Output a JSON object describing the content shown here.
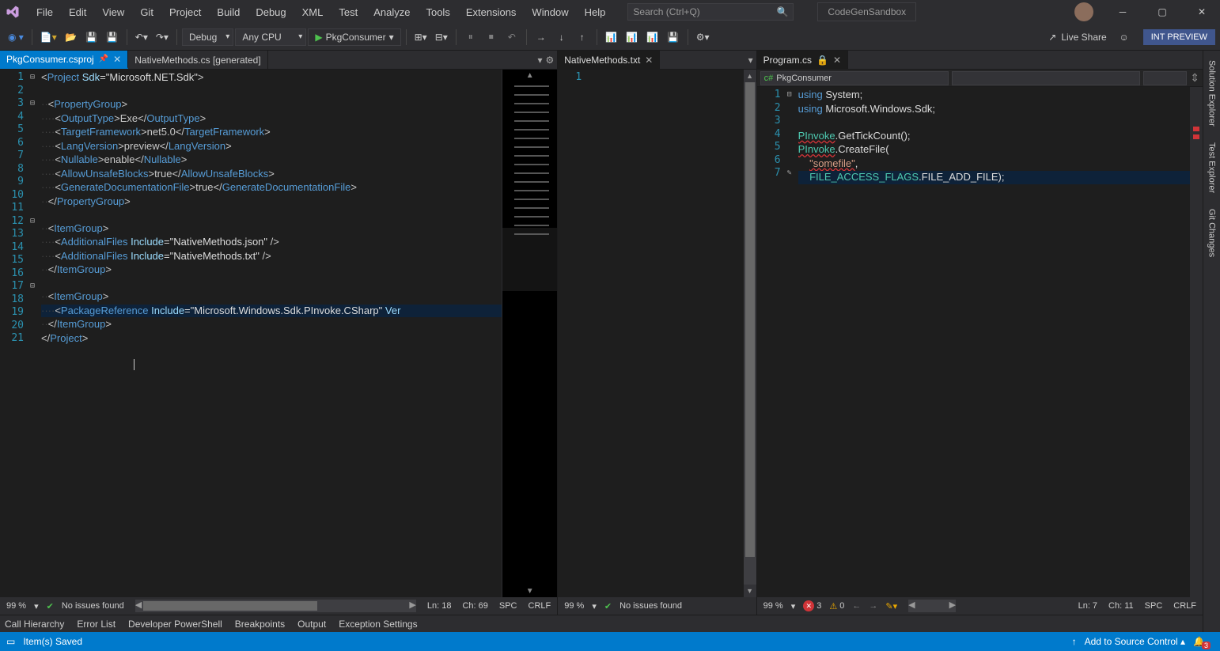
{
  "titlebar": {
    "menus": [
      "File",
      "Edit",
      "View",
      "Git",
      "Project",
      "Build",
      "Debug",
      "XML",
      "Test",
      "Analyze",
      "Tools",
      "Extensions",
      "Window",
      "Help"
    ],
    "search_placeholder": "Search (Ctrl+Q)",
    "solution_name": "CodeGenSandbox"
  },
  "toolbar": {
    "config": "Debug",
    "platform": "Any CPU",
    "run_target": "PkgConsumer",
    "live_share": "Live Share",
    "int_preview": "INT PREVIEW"
  },
  "pane1": {
    "tabs": [
      {
        "label": "PkgConsumer.csproj",
        "active": true,
        "pinned": true
      },
      {
        "label": "NativeMethods.cs [generated]",
        "active": false
      }
    ],
    "lines": 21,
    "status": {
      "zoom": "99 %",
      "issues": "No issues found",
      "ln": "Ln: 18",
      "ch": "Ch: 69",
      "ws": "SPC",
      "eol": "CRLF"
    }
  },
  "pane1_code": {
    "l1": {
      "open": "<",
      "tag": "Project",
      "sp": " ",
      "attr": "Sdk",
      "eq": "=",
      "q": "\"",
      "str": "Microsoft.NET.Sdk",
      "q2": "\"",
      "close": ">"
    },
    "l3": {
      "dots": "··",
      "open": "<",
      "tag": "PropertyGroup",
      "close": ">"
    },
    "l4": {
      "dots": "····",
      "open": "<",
      "tag": "OutputType",
      "close": ">",
      "txt": "Exe",
      "open2": "</",
      "tag2": "OutputType",
      "close2": ">"
    },
    "l5": {
      "dots": "····",
      "open": "<",
      "tag": "TargetFramework",
      "close": ">",
      "txt": "net5.0",
      "open2": "</",
      "tag2": "TargetFramework",
      "close2": ">"
    },
    "l6": {
      "dots": "····",
      "open": "<",
      "tag": "LangVersion",
      "close": ">",
      "txt": "preview",
      "open2": "</",
      "tag2": "LangVersion",
      "close2": ">"
    },
    "l7": {
      "dots": "····",
      "open": "<",
      "tag": "Nullable",
      "close": ">",
      "txt": "enable",
      "open2": "</",
      "tag2": "Nullable",
      "close2": ">"
    },
    "l8": {
      "dots": "····",
      "open": "<",
      "tag": "AllowUnsafeBlocks",
      "close": ">",
      "txt": "true",
      "open2": "</",
      "tag2": "AllowUnsafeBlocks",
      "close2": ">"
    },
    "l9": {
      "dots": "····",
      "open": "<",
      "tag": "GenerateDocumentationFile",
      "close": ">",
      "txt": "true",
      "open2": "</",
      "tag2": "GenerateDocumentationFile",
      "close2": ">"
    },
    "l10": {
      "dots": "··",
      "open": "</",
      "tag": "PropertyGroup",
      "close": ">"
    },
    "l12": {
      "dots": "··",
      "open": "<",
      "tag": "ItemGroup",
      "close": ">"
    },
    "l13": {
      "dots": "····",
      "open": "<",
      "tag": "AdditionalFiles",
      "sp": " ",
      "attr": "Include",
      "eq": "=",
      "q": "\"",
      "str": "NativeMethods.json",
      "q2": "\"",
      "close": " />"
    },
    "l14": {
      "dots": "····",
      "open": "<",
      "tag": "AdditionalFiles",
      "sp": " ",
      "attr": "Include",
      "eq": "=",
      "q": "\"",
      "str": "NativeMethods.txt",
      "q2": "\"",
      "close": " />"
    },
    "l15": {
      "dots": "··",
      "open": "</",
      "tag": "ItemGroup",
      "close": ">"
    },
    "l17": {
      "dots": "··",
      "open": "<",
      "tag": "ItemGroup",
      "close": ">"
    },
    "l18": {
      "dots": "····",
      "open": "<",
      "tag": "PackageReference",
      "sp": " ",
      "attr": "Include",
      "eq": "=",
      "q": "\"",
      "str": "Microsoft.Windows.Sdk.PInvoke.CSharp",
      "q2": "\"",
      "sp2": " ",
      "attr2": "Ver"
    },
    "l19": {
      "dots": "··",
      "open": "</",
      "tag": "ItemGroup",
      "close": ">"
    },
    "l20": {
      "open": "</",
      "tag": "Project",
      "close": ">"
    }
  },
  "pane2": {
    "tabs": [
      {
        "label": "NativeMethods.txt",
        "active": true
      }
    ],
    "lines": 1,
    "status": {
      "zoom": "99 %",
      "issues": "No issues found"
    }
  },
  "pane3": {
    "tabs": [
      {
        "label": "Program.cs",
        "active": true
      }
    ],
    "nav": "PkgConsumer",
    "lines": 7,
    "status": {
      "zoom": "99 %",
      "errors": "3",
      "warnings": "0",
      "ln": "Ln: 7",
      "ch": "Ch: 11",
      "ws": "SPC",
      "eol": "CRLF"
    }
  },
  "pane3_code": {
    "l1": {
      "kw": "using",
      "sp": " ",
      "ns": "System",
      "semi": ";"
    },
    "l2": {
      "kw": "using",
      "sp": " ",
      "ns": "Microsoft.Windows.Sdk",
      "semi": ";"
    },
    "l4": {
      "type": "PInvoke",
      "dot": ".",
      "mem": "GetTickCount",
      "paren": "();"
    },
    "l5": {
      "type": "PInvoke",
      "dot": ".",
      "mem": "CreateFile",
      "paren": "("
    },
    "l6": {
      "indent": "    ",
      "str": "\"somefile\"",
      "comma": ","
    },
    "l7": {
      "indent": "    ",
      "type": "FILE_ACCESS_FLAGS",
      "dot": ".",
      "mem": "FILE_ADD_FILE",
      "paren": ");"
    }
  },
  "bottom_tabs": [
    "Call Hierarchy",
    "Error List",
    "Developer PowerShell",
    "Breakpoints",
    "Output",
    "Exception Settings"
  ],
  "statusbar": {
    "saved": "Item(s) Saved",
    "source_control": "Add to Source Control",
    "notif": "3"
  },
  "side_panels": [
    "Solution Explorer",
    "Test Explorer",
    "Git Changes"
  ]
}
